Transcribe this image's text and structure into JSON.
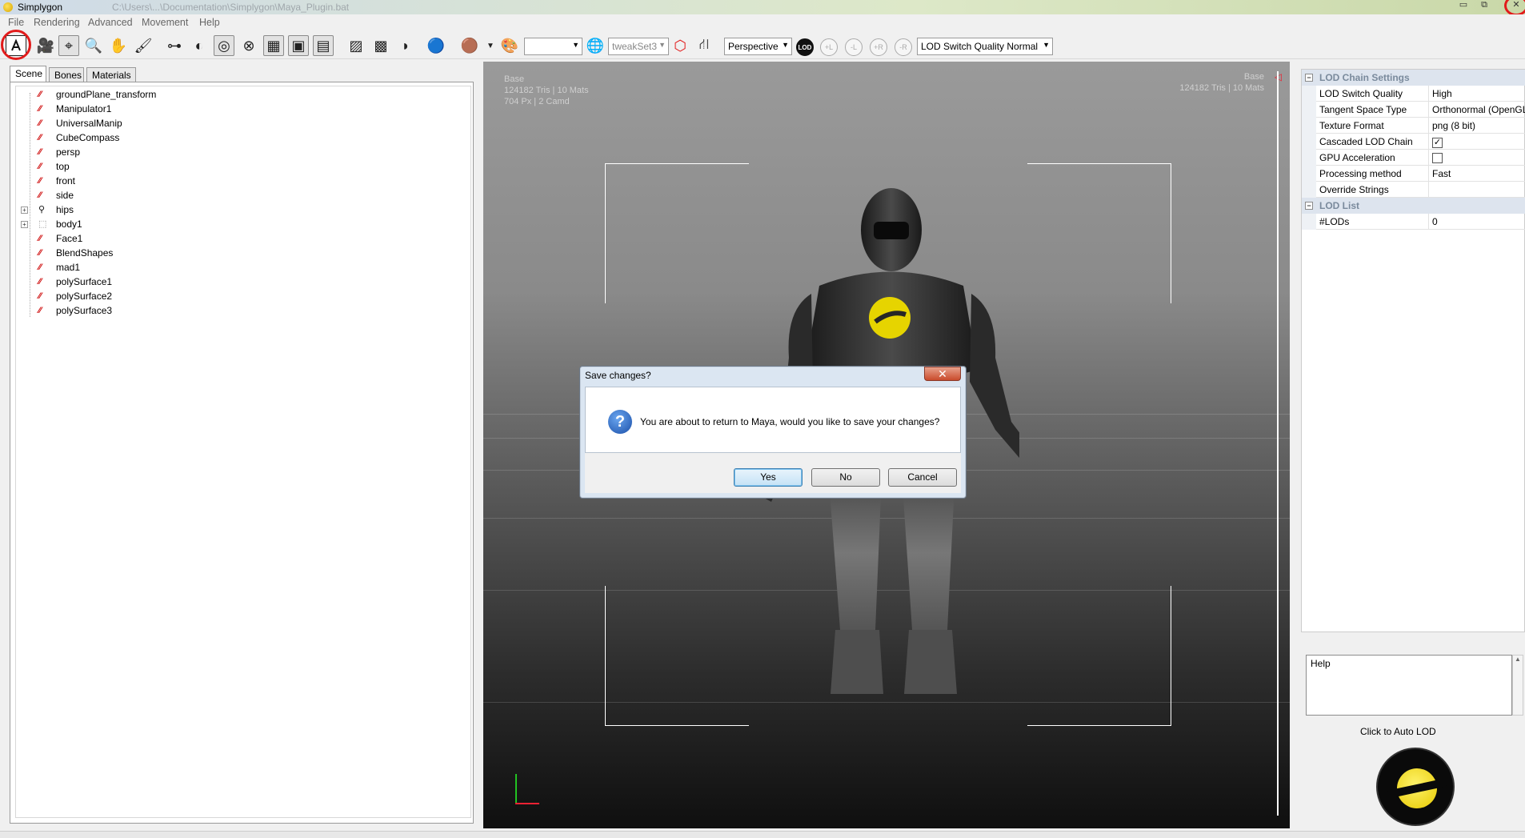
{
  "window": {
    "title": "Simplygon",
    "path_hint": "C:\\Users\\...\\Documentation\\Simplygon\\Maya_Plugin.bat",
    "controls": {
      "minimize": "▭",
      "restore": "⧉",
      "close": "✕"
    }
  },
  "menu": {
    "items": [
      "File",
      "Rendering",
      "Advanced",
      "Movement",
      "Help"
    ]
  },
  "toolbar": {
    "color_combo_value": "",
    "tweak_combo_value": "tweakSet3",
    "camera_combo_value": "Perspective",
    "lod_quality_combo_value": "LOD Switch Quality Normal",
    "lod_badge": "LOD",
    "lod_buttons": [
      "+L",
      "-L",
      "+R",
      "-R"
    ]
  },
  "scene_panel": {
    "tabs": [
      "Scene",
      "Bones",
      "Materials"
    ],
    "active_tab": "Scene",
    "nodes": [
      {
        "label": "groundPlane_transform",
        "icon": "transform-icon",
        "expandable": false
      },
      {
        "label": "Manipulator1",
        "icon": "transform-icon",
        "expandable": false
      },
      {
        "label": "UniversalManip",
        "icon": "transform-icon",
        "expandable": false
      },
      {
        "label": "CubeCompass",
        "icon": "transform-icon",
        "expandable": false
      },
      {
        "label": "persp",
        "icon": "transform-icon",
        "expandable": false
      },
      {
        "label": "top",
        "icon": "transform-icon",
        "expandable": false
      },
      {
        "label": "front",
        "icon": "transform-icon",
        "expandable": false
      },
      {
        "label": "side",
        "icon": "transform-icon",
        "expandable": false
      },
      {
        "label": "hips",
        "icon": "joint-icon",
        "expandable": true
      },
      {
        "label": "body1",
        "icon": "group-icon",
        "expandable": true
      },
      {
        "label": "Face1",
        "icon": "transform-icon",
        "expandable": false
      },
      {
        "label": "BlendShapes",
        "icon": "transform-icon",
        "expandable": false
      },
      {
        "label": "mad1",
        "icon": "transform-icon",
        "expandable": false
      },
      {
        "label": "polySurface1",
        "icon": "transform-icon",
        "expandable": false
      },
      {
        "label": "polySurface2",
        "icon": "transform-icon",
        "expandable": false
      },
      {
        "label": "polySurface3",
        "icon": "transform-icon",
        "expandable": false
      }
    ]
  },
  "viewport": {
    "left_info": {
      "name": "Base",
      "stats1": "124182 Tris  |  10 Mats",
      "stats2": "704 Px  |  2 Camd"
    },
    "right_info": {
      "name": "Base",
      "stats1": "124182 Tris  |  10 Mats"
    }
  },
  "dialog": {
    "title": "Save changes?",
    "message": "You are about to return to Maya, would you like to save your changes?",
    "buttons": {
      "yes": "Yes",
      "no": "No",
      "cancel": "Cancel"
    },
    "close_glyph": "✕",
    "icon_glyph": "?"
  },
  "properties": {
    "categories": [
      {
        "name": "LOD Chain Settings",
        "rows": [
          {
            "key": "LOD Switch Quality",
            "value": "High",
            "type": "text"
          },
          {
            "key": "Tangent Space Type",
            "value": "Orthonormal (OpenGL)",
            "type": "text"
          },
          {
            "key": "Texture Format",
            "value": "png (8 bit)",
            "type": "text"
          },
          {
            "key": "Cascaded LOD Chain",
            "value": "✓",
            "type": "checkbox"
          },
          {
            "key": "GPU Acceleration",
            "value": "",
            "type": "checkbox"
          },
          {
            "key": "Processing method",
            "value": "Fast",
            "type": "text"
          },
          {
            "key": "Override Strings",
            "value": "",
            "type": "text"
          }
        ]
      },
      {
        "name": "LOD List",
        "rows": [
          {
            "key": "#LODs",
            "value": "0",
            "type": "text"
          }
        ]
      }
    ]
  },
  "help": {
    "label": "Help"
  },
  "auto_lod": {
    "label": "Click to Auto LOD"
  },
  "colors": {
    "highlight_circle": "#e21b1b",
    "accent_yellow": "#e6c800",
    "dialog_frame": "#dbe6f2"
  }
}
